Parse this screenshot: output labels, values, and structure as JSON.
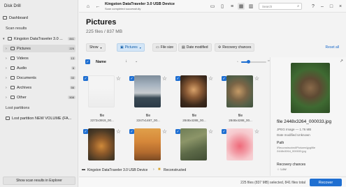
{
  "app": {
    "title": "Disk Drill"
  },
  "sidebar": {
    "dashboard": "Dashboard",
    "scan_results_heading": "Scan results",
    "device_item": {
      "label": "Kingston DataTraveler 3.0 ...",
      "count": "841"
    },
    "items": [
      {
        "label": "Pictures",
        "count": "225"
      },
      {
        "label": "Videos",
        "count": "13"
      },
      {
        "label": "Audio",
        "count": "6"
      },
      {
        "label": "Documents",
        "count": "33"
      },
      {
        "label": "Archives",
        "count": "56"
      },
      {
        "label": "Other",
        "count": "508"
      }
    ],
    "lost_partitions_heading": "Lost partitions",
    "lost_partition_item": "Lost partition NEW VOLUME (FA...",
    "explorer_button": "Show scan results in Explorer"
  },
  "topbar": {
    "device_name": "Kingston DataTraveler 3.0 USB Device",
    "device_status": "Scan completed successfully",
    "search_placeholder": "Search"
  },
  "main": {
    "title": "Pictures",
    "subtitle": "225 files / 837 MB",
    "filters": {
      "show": "Show",
      "pictures": "Pictures",
      "file_size": "File size",
      "date_modified": "Date modified",
      "recovery_chances": "Recovery chances",
      "reset": "Reset all"
    },
    "list_header": {
      "name": "Name"
    },
    "cards": [
      {
        "name": "file",
        "name2": "2272x3919_00..."
      },
      {
        "name": "file",
        "name2": "2247x1487_00..."
      },
      {
        "name": "file",
        "name2": "2848x4288_00..."
      },
      {
        "name": "file",
        "name2": "2848x4288_00..."
      },
      {
        "name": "",
        "name2": ""
      },
      {
        "name": "",
        "name2": ""
      },
      {
        "name": "",
        "name2": ""
      },
      {
        "name": "",
        "name2": ""
      }
    ]
  },
  "preview": {
    "filename": "file 2448x3264_000033.jpg",
    "type": "JPEG Image — 1.76 MB",
    "date": "Date modified Unknown",
    "path_label": "Path",
    "path": "\\Reconstructed\\Pictures\\jpg\\file 2448x3264_000033.jpg",
    "recovery_label": "Recovery chances",
    "recovery_value": "Low"
  },
  "breadcrumb": {
    "device": "Kingston DataTraveler 3.0 USB Device",
    "folder": "Reconstructed"
  },
  "status": {
    "text": "225 files (837 MB) selected, 841 files total",
    "recover_button": "Recover"
  },
  "colors": {
    "accent": "#1f6fd1",
    "selected_filter_bg": "#d4e6f7"
  }
}
